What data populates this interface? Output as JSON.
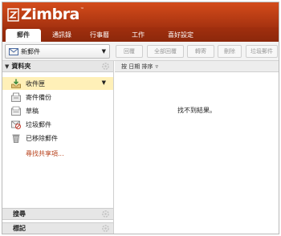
{
  "app": {
    "logo_text": "Zimbra",
    "logo_tm": "™"
  },
  "tabs": [
    {
      "label": "郵件"
    },
    {
      "label": "通訊錄"
    },
    {
      "label": "行事曆"
    },
    {
      "label": "工作"
    },
    {
      "label": "喜好設定"
    }
  ],
  "toolbar": {
    "new_label": "新郵件",
    "buttons": [
      {
        "label": "回覆"
      },
      {
        "label": "全部回覆"
      },
      {
        "label": "轉寄"
      },
      {
        "label": "刪除"
      },
      {
        "label": "垃圾郵件"
      }
    ]
  },
  "folders": {
    "title": "資料夾",
    "items": [
      {
        "label": "收件匣",
        "icon": "inbox-icon"
      },
      {
        "label": "寄件備份",
        "icon": "sent-icon"
      },
      {
        "label": "草稿",
        "icon": "drafts-icon"
      },
      {
        "label": "垃圾郵件",
        "icon": "junk-icon"
      },
      {
        "label": "已移除郵件",
        "icon": "trash-icon"
      }
    ],
    "find_shares": "尋找共享項..."
  },
  "sections": {
    "search": "搜尋",
    "tags": "標記"
  },
  "list": {
    "sort_label": "按 日期 排序",
    "empty_text": "找不到結果。"
  },
  "colors": {
    "brand": "#c9431a",
    "selected_row": "#fff0b8",
    "link": "#b8411b"
  }
}
